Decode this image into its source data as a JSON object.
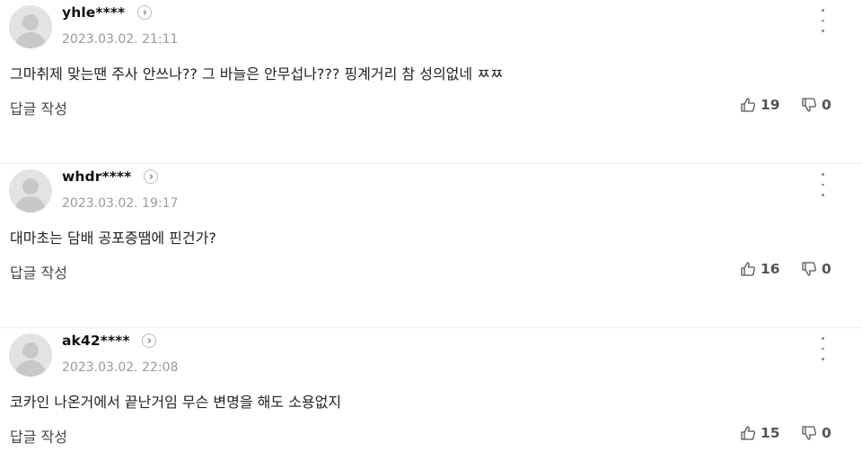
{
  "comments": [
    {
      "nickname": "yhle****",
      "date": "2023.03.02. 21:11",
      "text": "그마취제 맞는땐 주사 안쓰나?? 그 바늘은 안무섭나??? 핑계거리 참 성의없네 ㅉㅉ",
      "reply_label": "답글 작성",
      "likes": "19",
      "dislikes": "0"
    },
    {
      "nickname": "whdr****",
      "date": "2023.03.02. 19:17",
      "text": "대마초는 담배 공포증땜에 핀건가?",
      "reply_label": "답글 작성",
      "likes": "16",
      "dislikes": "0"
    },
    {
      "nickname": "ak42****",
      "date": "2023.03.02. 22:08",
      "text": "코카인 나온거에서 끝난거임 무슨 변명을 해도 소용없지",
      "reply_label": "답글 작성",
      "likes": "15",
      "dislikes": "0"
    }
  ]
}
